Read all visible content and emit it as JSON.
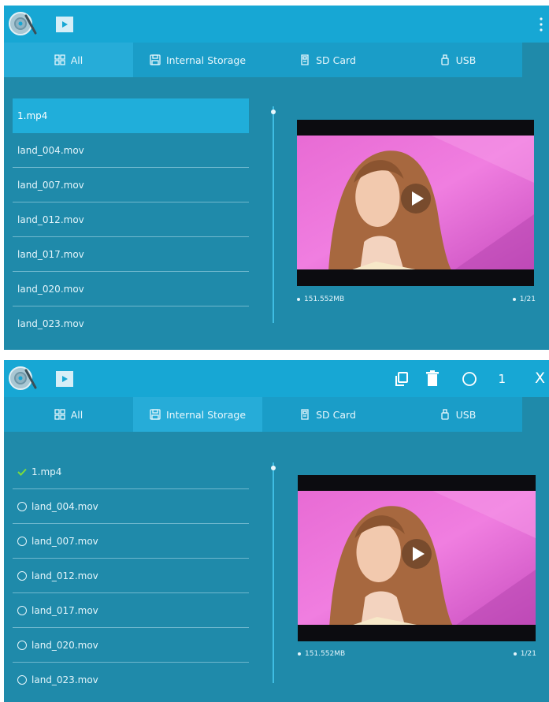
{
  "tabs": {
    "all": "All",
    "internal_storage": "Internal Storage",
    "sd_card": "SD Card",
    "usb": "USB"
  },
  "files": [
    "1.mp4",
    "land_004.mov",
    "land_007.mov",
    "land_012.mov",
    "land_017.mov",
    "land_020.mov",
    "land_023.mov"
  ],
  "preview": {
    "file_size": "151.552MB",
    "page_indicator": "1/21"
  },
  "selection_toolbar": {
    "count": "1",
    "close_label": "X"
  },
  "icons": {
    "logo": "disc-logo-icon",
    "media": "video-play-icon",
    "overflow": "more-vert-icon",
    "copy": "copy-icon",
    "delete": "trash-icon",
    "select_all": "circle-select-icon",
    "check": "check-icon"
  },
  "colors": {
    "topbar": "#17a7d4",
    "tabs": "#1a9dc8",
    "active_tab": "#26acd8",
    "panel_bg": "#1f8aaa",
    "selected_row": "#20aeda",
    "check": "#7ddc3c"
  }
}
